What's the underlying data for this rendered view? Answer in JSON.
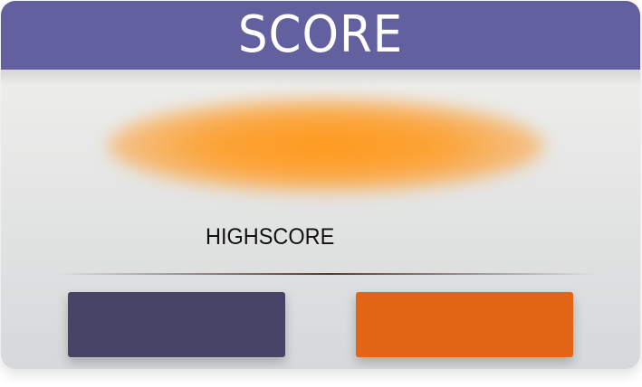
{
  "header": {
    "title": "SCORE"
  },
  "score": {
    "highscore_label": "HIGHSCORE"
  },
  "buttons": {
    "left_color": "#464467",
    "right_color": "#e26515"
  },
  "colors": {
    "title_bar": "#62609e",
    "score_glow": "#ff9a1c"
  }
}
